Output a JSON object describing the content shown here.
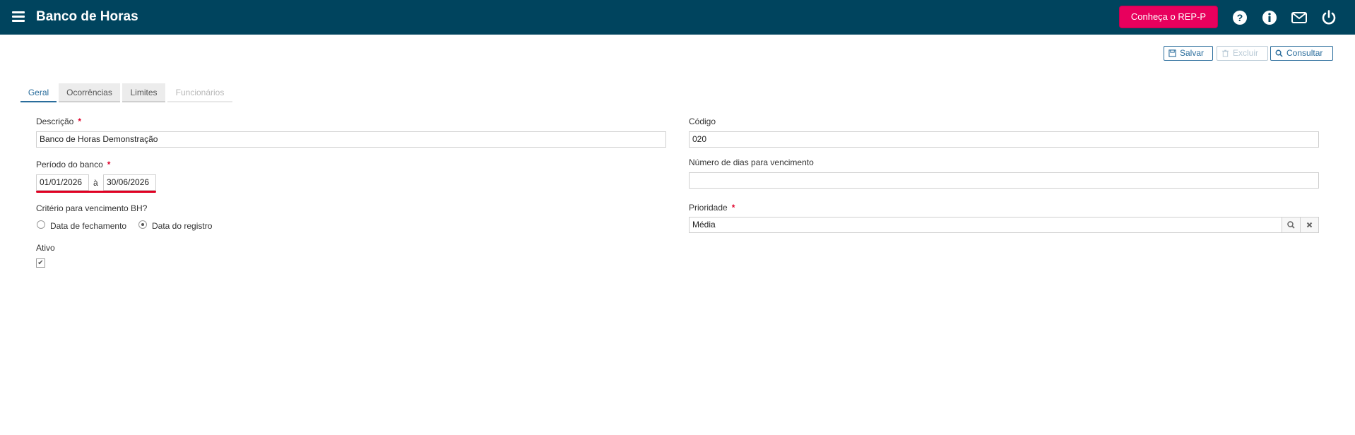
{
  "header": {
    "title": "Banco de Horas",
    "promo_label": "Conheça o REP-P",
    "icons": [
      "help-icon",
      "info-icon",
      "mail-icon",
      "power-icon"
    ],
    "bg_color": "#00445e",
    "promo_color": "#e8005d"
  },
  "toolbar": {
    "save_label": "Salvar",
    "delete_label": "Excluir",
    "query_label": "Consultar"
  },
  "tabs": [
    {
      "label": "Geral",
      "state": "active"
    },
    {
      "label": "Ocorrências",
      "state": "inactive"
    },
    {
      "label": "Limites",
      "state": "inactive"
    },
    {
      "label": "Funcionários",
      "state": "disabled"
    }
  ],
  "form": {
    "descricao": {
      "label": "Descrição",
      "value": "Banco de Horas Demonstração",
      "required": "*"
    },
    "periodo": {
      "label": "Período do banco",
      "required": "*",
      "start": "01/01/2026",
      "separator": "à",
      "end": "30/06/2026"
    },
    "criterio": {
      "label": "Critério para vencimento BH?",
      "options": [
        {
          "label": "Data de fechamento",
          "checked": false
        },
        {
          "label": "Data do registro",
          "checked": true
        }
      ]
    },
    "ativo": {
      "label": "Ativo",
      "checked": true,
      "check_glyph": "✔"
    },
    "codigo": {
      "label": "Código",
      "value": "020"
    },
    "dias_vencimento": {
      "label": "Número de dias para vencimento",
      "value": ""
    },
    "prioridade": {
      "label": "Prioridade",
      "required": "*",
      "value": "Média"
    }
  }
}
